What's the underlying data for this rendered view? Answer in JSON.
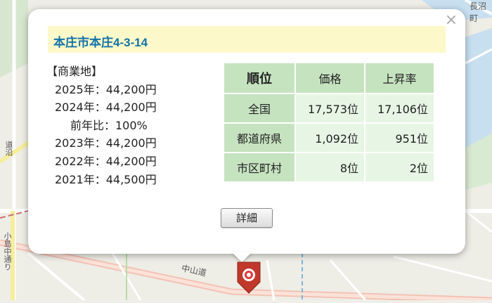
{
  "map": {
    "labels": [
      "長沼町",
      "中山道",
      "小島中通り",
      "道沿"
    ]
  },
  "popup": {
    "title": "本庄市本庄4-3-14",
    "close_glyph": "×",
    "price_list": {
      "category": "【商業地】",
      "rows": [
        "2025年：44,200円",
        "2024年：44,200円",
        "前年比：100%",
        "2023年：44,200円",
        "2022年：44,200円",
        "2021年：44,500円"
      ]
    },
    "rank_table": {
      "header": [
        "順位",
        "価格",
        "上昇率"
      ],
      "rows": [
        {
          "label": "全国",
          "price": "17,573位",
          "rate": "17,106位"
        },
        {
          "label": "都道府県",
          "price": "1,092位",
          "rate": "951位"
        },
        {
          "label": "市区町村",
          "price": "8位",
          "rate": "2位"
        }
      ]
    },
    "detail_button": "詳細"
  },
  "colors": {
    "title_bar": "#fcf8c9",
    "title_text": "#1573a8",
    "table_header": "#c6e3c0",
    "table_cell": "#e7f6e4",
    "marker": "#c0392b"
  },
  "icons": {
    "close": "close-icon",
    "marker": "map-pin-icon"
  }
}
